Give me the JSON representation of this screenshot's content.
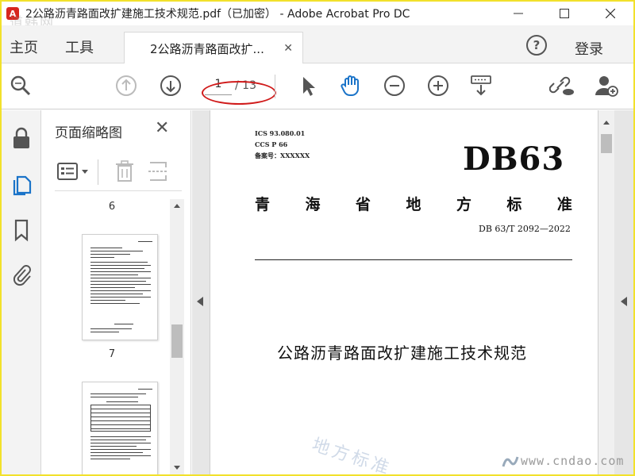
{
  "window": {
    "title": "2公路沥青路面改扩建施工技术规范.pdf（已加密） - Adobe Acrobat Pro DC",
    "app_icon_glyph": "⌥",
    "watermark_tl": "道韩网"
  },
  "menubar": {
    "home": "主页",
    "tools": "工具",
    "doc_tab": "2公路沥青路面改扩...",
    "help": "?",
    "login": "登录"
  },
  "toolbar": {
    "current_page": "1",
    "total_pages": "/ 13"
  },
  "thumbnails": {
    "title": "页面缩略图",
    "close": "✕",
    "pages": [
      "6",
      "7"
    ]
  },
  "document": {
    "ics": "ICS 93.080.01",
    "ccs": "CCS P 66",
    "filing": "备案号：XXXXXX",
    "db_code": "DB63",
    "standard_chars": [
      "青",
      "海",
      "省",
      "地",
      "方",
      "标",
      "准"
    ],
    "std_number": "DB 63/T 2092—2022",
    "title": "公路沥青路面改扩建施工技术规范",
    "watermark_diag": "地方标准",
    "watermark_site": "www.cndao.com"
  },
  "colors": {
    "accent": "#1a73c8",
    "annotation": "#d01a1a",
    "frame": "#f2e12b"
  }
}
